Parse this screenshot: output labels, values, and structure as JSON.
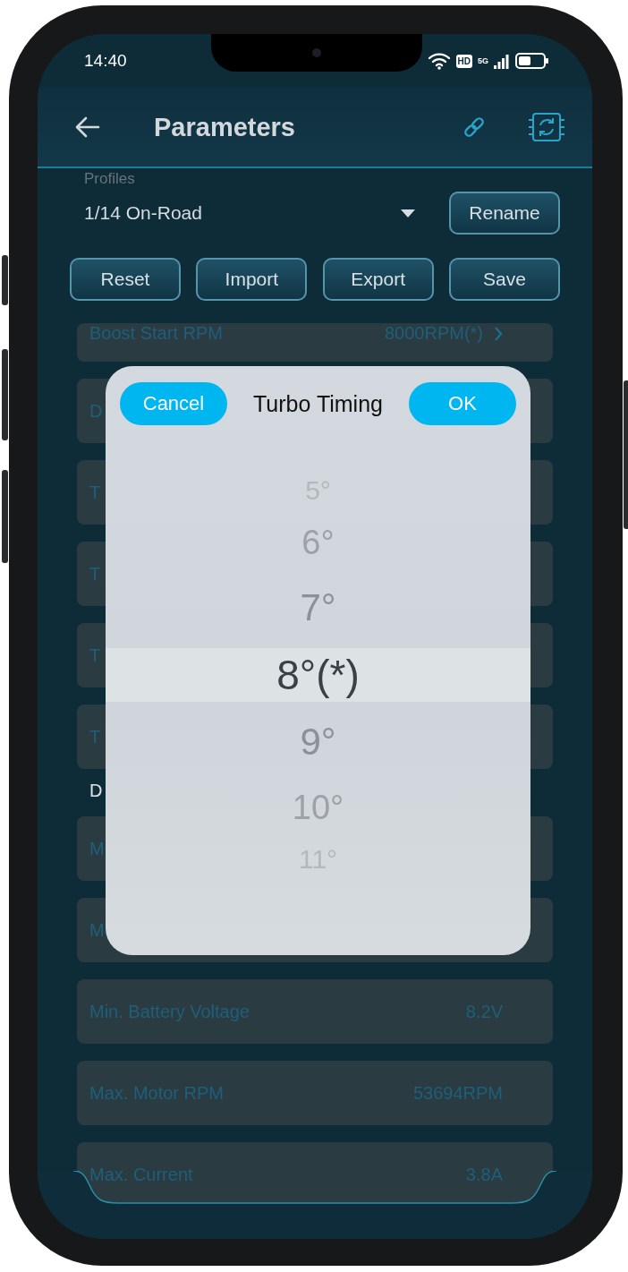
{
  "status_bar": {
    "time": "14:40",
    "hd_badge": "HD",
    "network": "5G"
  },
  "header": {
    "title": "Parameters"
  },
  "profiles": {
    "label": "Profiles",
    "value": "1/14 On-Road",
    "rename_button": "Rename"
  },
  "actions": [
    "Reset",
    "Import",
    "Export",
    "Save"
  ],
  "parameters": [
    {
      "kind": "link",
      "label": "Boost Start RPM",
      "value": "8000RPM(*)"
    },
    {
      "kind": "row",
      "label": "D"
    },
    {
      "kind": "row",
      "label": "T"
    },
    {
      "kind": "row",
      "label": "T"
    },
    {
      "kind": "row",
      "label": "T"
    },
    {
      "kind": "row",
      "label": "T"
    },
    {
      "kind": "section",
      "label": "D"
    },
    {
      "kind": "row",
      "label": "M"
    },
    {
      "kind": "row",
      "label": "M"
    },
    {
      "kind": "row",
      "label": "Min. Battery Voltage",
      "value": "8.2V"
    },
    {
      "kind": "row",
      "label": "Max. Motor RPM",
      "value": "53694RPM"
    },
    {
      "kind": "row",
      "label": "Max. Current",
      "value": "3.8A"
    }
  ],
  "dialog": {
    "title": "Turbo Timing",
    "cancel": "Cancel",
    "ok": "OK",
    "options": [
      {
        "label": "5°",
        "selected": false
      },
      {
        "label": "6°",
        "selected": false
      },
      {
        "label": "7°",
        "selected": false
      },
      {
        "label": "8°(*)",
        "selected": true
      },
      {
        "label": "9°",
        "selected": false
      },
      {
        "label": "10°",
        "selected": false
      },
      {
        "label": "11°",
        "selected": false
      }
    ]
  }
}
